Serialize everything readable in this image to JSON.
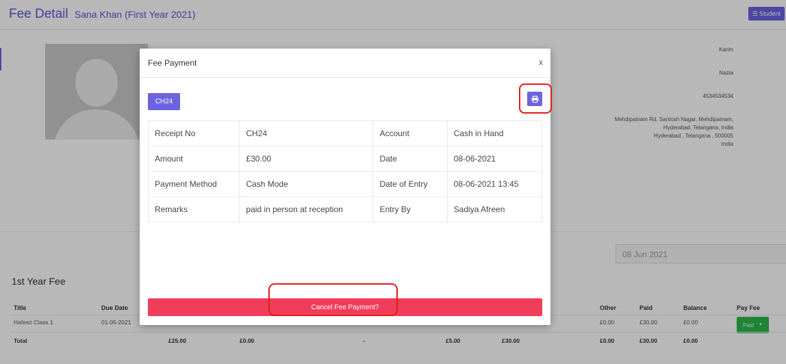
{
  "header": {
    "title": "Fee Detail",
    "subtitle": "Sana Khan (First Year 2021)",
    "student_button": "Student"
  },
  "profile": {
    "father": "Karim",
    "mother": "Nazia",
    "phone": "4534534534",
    "address": [
      "Mehdipatnam Rd, Santosh Nagar, Mehdipatnam,",
      "Hyderabad, Telangana, India",
      "Hyderabad , Telangana , 500005",
      "India"
    ]
  },
  "date_filter": {
    "value": "08 Jun 2021"
  },
  "fee_section": {
    "title": "1st Year Fee",
    "headers": {
      "title": "Title",
      "due_date": "Due Date",
      "other": "Other",
      "paid": "Paid",
      "balance": "Balance",
      "pay_fee": "Pay Fee"
    },
    "row": {
      "title": "Hafeez Class 1",
      "due_date": "01-05-2021",
      "other": "£0.00",
      "paid": "£30.00",
      "balance": "£0.00",
      "action": "Paid"
    },
    "total": {
      "label": "Total",
      "c1": "£25.00",
      "c2": "£0.00",
      "c3": "-",
      "c4": "£5.00",
      "c5": "£30.00",
      "other": "£0.00",
      "paid": "£30.00",
      "balance": "£0.00"
    }
  },
  "modal": {
    "title": "Fee Payment",
    "close": "x",
    "badge": "CH24",
    "details": [
      {
        "label": "Receipt No",
        "value": "CH24",
        "label2": "Account",
        "value2": "Cash in Hand"
      },
      {
        "label": "Amount",
        "value": "£30.00",
        "label2": "Date",
        "value2": "08-06-2021"
      },
      {
        "label": "Payment Method",
        "value": "Cash Mode",
        "label2": "Date of Entry",
        "value2": "08-06-2021 13:45"
      },
      {
        "label": "Remarks",
        "value": "paid in person at reception",
        "label2": "Entry By",
        "value2": "Sadiya Afreen"
      }
    ],
    "cancel_button": "Cancel Fee Payment?"
  },
  "colors": {
    "accent": "#6c63e0",
    "danger": "#f03e5a",
    "success": "#2db84d",
    "highlight": "#e01a1a"
  }
}
